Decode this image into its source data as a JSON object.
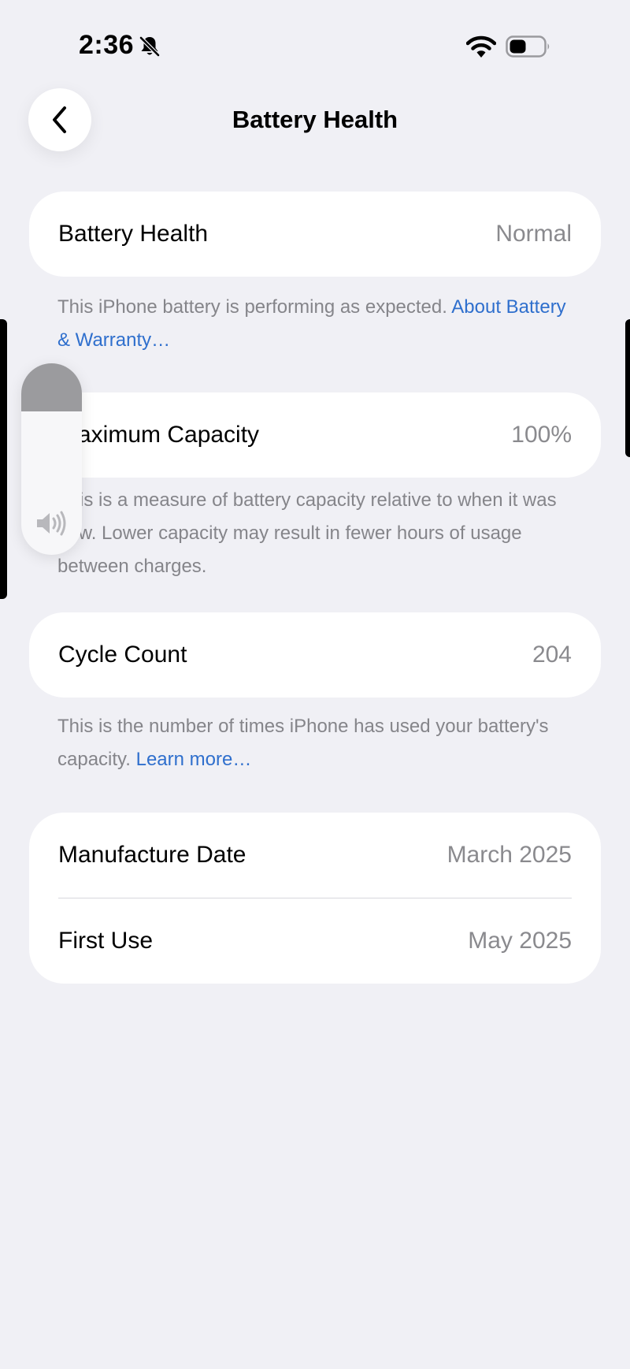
{
  "status_bar": {
    "time": "2:36",
    "icons": [
      "bell-off-icon",
      "wifi-icon",
      "battery-icon"
    ]
  },
  "nav": {
    "back_icon": "chevron-left-icon",
    "title": "Battery Health"
  },
  "battery_health": {
    "label": "Battery Health",
    "value": "Normal",
    "footnote": "This iPhone battery is performing as expected. ",
    "link": "About Battery & Warranty…"
  },
  "max_capacity": {
    "label": "Maximum Capacity",
    "value": "100%",
    "footnote": "This is a measure of battery capacity relative to when it was new. Lower capacity may result in fewer hours of usage between charges."
  },
  "cycle_count": {
    "label": "Cycle Count",
    "value": "204",
    "footnote": "This is the number of times iPhone has used your battery's capacity. ",
    "link": "Learn more…"
  },
  "dates": {
    "manufacture_label": "Manufacture Date",
    "manufacture_value": "March 2025",
    "first_use_label": "First Use",
    "first_use_value": "May 2025"
  },
  "volume_hud": {
    "level": 0.25,
    "icon": "speaker-icon"
  },
  "colors": {
    "background": "#f0f0f5",
    "link": "#2f6fcd",
    "secondary_text": "#85858a",
    "volume_fill": "#9b9b9e"
  }
}
